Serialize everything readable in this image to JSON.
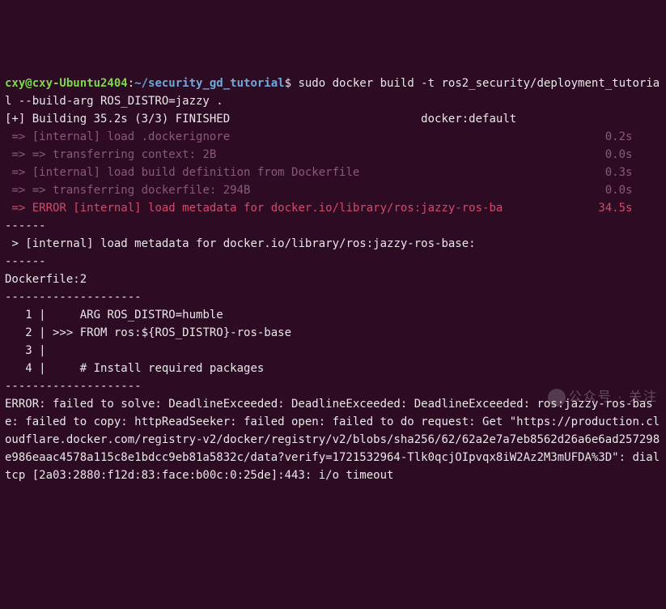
{
  "prompt": {
    "user": "cxy@cxy-Ubuntu2404",
    "sep": ":",
    "path": "~/security_gd_tutorial",
    "dollar": "$ ",
    "command": "sudo docker build -t ros2_security/deployment_tutorial --build-arg ROS_DISTRO=jazzy ."
  },
  "build_header": {
    "left": "[+] Building 35.2s (3/3) FINISHED",
    "right": "docker:default"
  },
  "steps": [
    {
      "text": " => [internal] load .dockerignore",
      "time": "0.2s",
      "cls": "step"
    },
    {
      "text": " => => transferring context: 2B",
      "time": "0.0s",
      "cls": "step-transfer"
    },
    {
      "text": " => [internal] load build definition from Dockerfile",
      "time": "0.3s",
      "cls": "step"
    },
    {
      "text": " => => transferring dockerfile: 294B",
      "time": "0.0s",
      "cls": "step-transfer"
    },
    {
      "text": " => ERROR [internal] load metadata for docker.io/library/ros:jazzy-ros-ba",
      "time": "34.5s",
      "cls": "error-step"
    }
  ],
  "sep1": "------",
  "meta_line": " > [internal] load metadata for docker.io/library/ros:jazzy-ros-base:",
  "sep2": "------",
  "dockerfile_label": "Dockerfile:2",
  "dash1": "--------------------",
  "dockerfile_lines": [
    "   1 |     ARG ROS_DISTRO=humble",
    "   2 | >>> FROM ros:${ROS_DISTRO}-ros-base",
    "   3 |     ",
    "   4 |     # Install required packages"
  ],
  "dash2": "--------------------",
  "error_msg": "ERROR: failed to solve: DeadlineExceeded: DeadlineExceeded: DeadlineExceeded: ros:jazzy-ros-base: failed to copy: httpReadSeeker: failed open: failed to do request: Get \"https://production.cloudflare.docker.com/registry-v2/docker/registry/v2/blobs/sha256/62/62a2e7a7eb8562d26a6e6ad257298e986eaac4578a115c8e1bdcc9eb81a5832c/data?verify=1721532964-Tlk0qcjOIpvqx8iW2Az2M3mUFDA%3D\": dial tcp [2a03:2880:f12d:83:face:b00c:0:25de]:443: i/o timeout",
  "watermark": "公众号 · 关注"
}
